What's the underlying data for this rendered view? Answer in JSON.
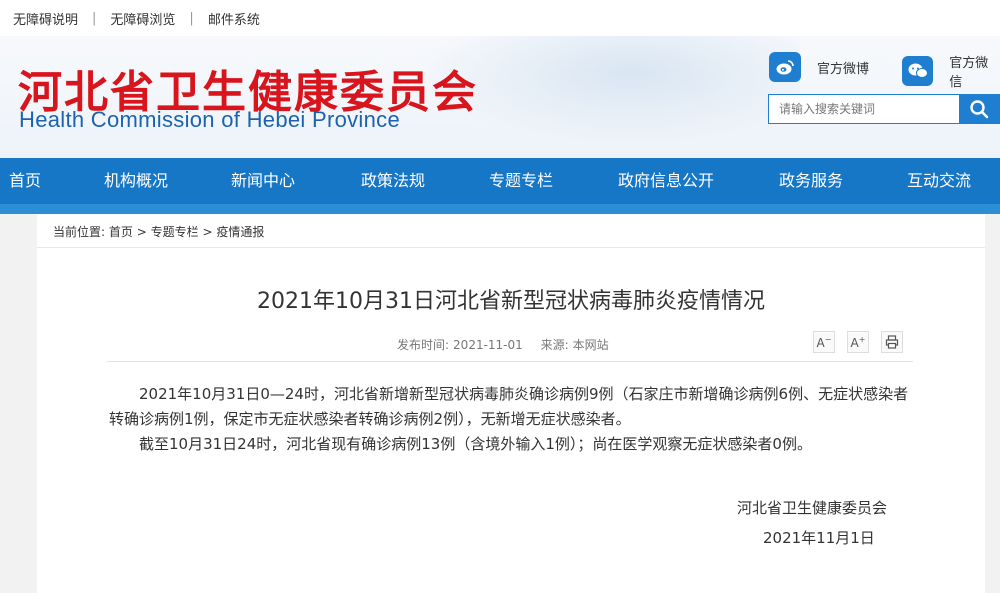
{
  "topbar": {
    "links": [
      "无障碍说明",
      "无障碍浏览",
      "邮件系统"
    ],
    "separator": "|"
  },
  "header": {
    "title_cn": "河北省卫生健康委员会",
    "title_en": "Health Commission of Hebei Province",
    "weibo_label": "官方微博",
    "wechat_label": "官方微信",
    "search_placeholder": "请输入搜索关键词"
  },
  "nav": {
    "items": [
      "首页",
      "机构概况",
      "新闻中心",
      "政策法规",
      "专题专栏",
      "政府信息公开",
      "政务服务",
      "互动交流"
    ]
  },
  "breadcrumb": {
    "label": "当前位置:",
    "path": [
      "首页",
      "专题专栏",
      "疫情通报"
    ],
    "sep": ">"
  },
  "article": {
    "title": "2021年10月31日河北省新型冠状病毒肺炎疫情情况",
    "publish_time_label": "发布时间:",
    "publish_time": "2021-11-01",
    "source_label": "来源:",
    "source": "本网站",
    "tool_font_smaller": "A",
    "tool_font_larger": "A",
    "paragraphs": [
      "2021年10月31日0—24时，河北省新增新型冠状病毒肺炎确诊病例9例（石家庄市新增确诊病例6例、无症状感染者转确诊病例1例，保定市无症状感染者转确诊病例2例），无新增无症状感染者。",
      "截至10月31日24时，河北省现有确诊病例13例（含境外输入1例）；尚在医学观察无症状感染者0例。"
    ],
    "signature_org": "河北省卫生健康委员会",
    "signature_date": "2021年11月1日"
  },
  "colors": {
    "brand_red": "#d8151c",
    "brand_blue": "#1777c7",
    "en_title_blue": "#1a63b0"
  }
}
